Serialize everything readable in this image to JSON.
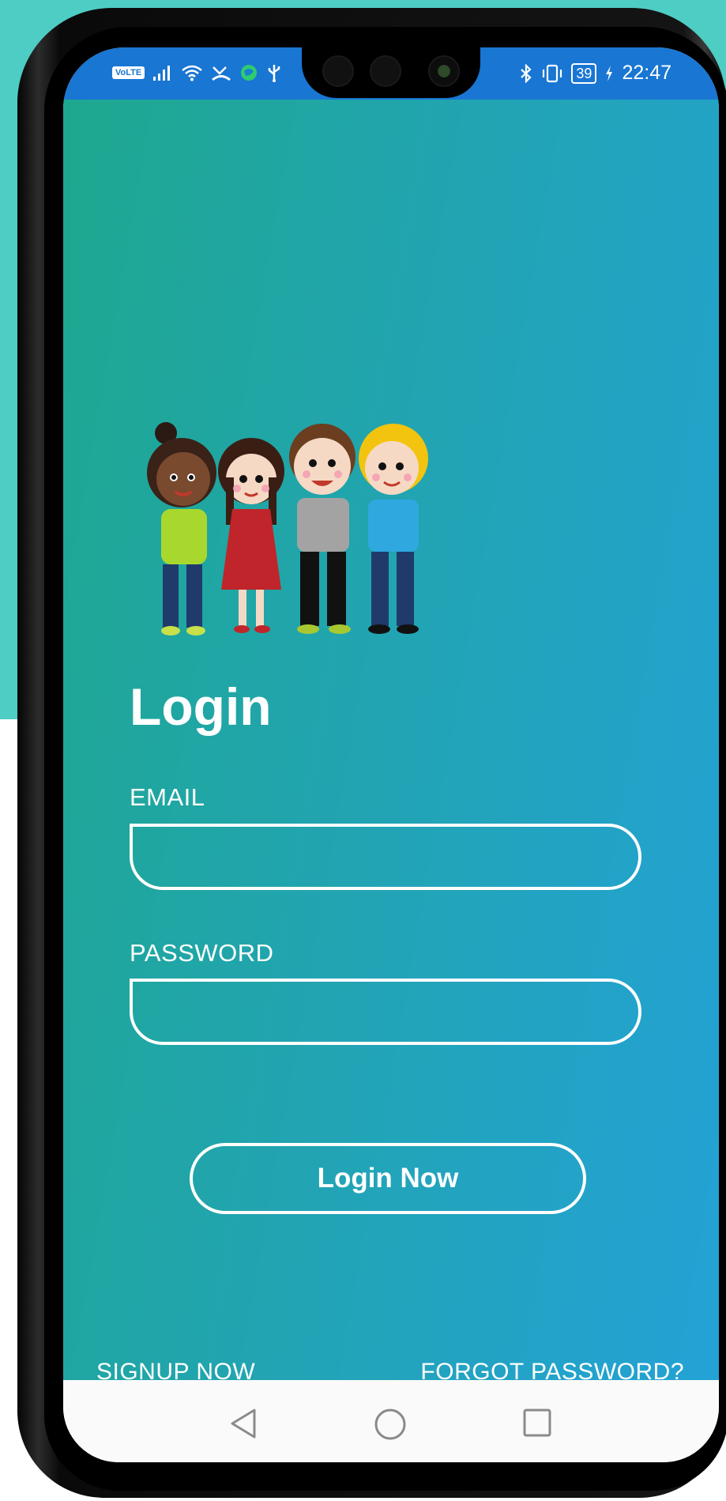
{
  "status_bar": {
    "volte": "VoLTE",
    "time": "22:47",
    "battery": "39",
    "icons": [
      "signal-icon",
      "wifi-icon",
      "missed-call-icon",
      "vpn-icon",
      "usb-icon",
      "bluetooth-icon",
      "vibrate-icon",
      "battery-icon",
      "charging-icon"
    ]
  },
  "login": {
    "title": "Login",
    "email_label": "EMAIL",
    "email_value": "",
    "password_label": "PASSWORD",
    "password_value": "",
    "login_button": "Login Now",
    "signup_link": "SIGNUP NOW",
    "forgot_link": "FORGOT PASSWORD?"
  },
  "nav": {
    "icons": [
      "back-icon",
      "home-icon",
      "recents-icon"
    ]
  },
  "colors": {
    "backdrop": "#4ecdc4",
    "status_bar": "#1976d2",
    "gradient_start": "#1ea88f",
    "gradient_end": "#23a2d6",
    "text": "#ffffff"
  }
}
